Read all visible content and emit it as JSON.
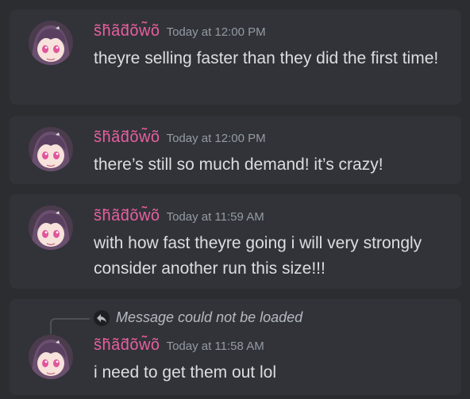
{
  "messages": [
    {
      "username": "s̃h̃ãd̃õw̃õ",
      "timestamp": "Today at 12:00 PM",
      "content": "theyre selling faster than they did the first time!"
    },
    {
      "username": "s̃h̃ãd̃õw̃õ",
      "timestamp": "Today at 12:00 PM",
      "content": "there’s still so much demand! it’s crazy!"
    },
    {
      "username": "s̃h̃ãd̃õw̃õ",
      "timestamp": "Today at 11:59 AM",
      "content": "with how fast theyre going i will very strongly consider another run this size!!!"
    },
    {
      "reply_preview": "Message could not be loaded",
      "username": "s̃h̃ãd̃õw̃õ",
      "timestamp": "Today at 11:58 AM",
      "content": "i need to get them out lol"
    }
  ],
  "icons": {
    "avatar": "anime-girl-avatar-icon",
    "reply": "reply-arrow-icon"
  },
  "colors": {
    "background": "#2b2d31",
    "message_card": "#313338",
    "username": "#e85fa0",
    "timestamp": "#949ba4",
    "text": "#dbdee1"
  }
}
